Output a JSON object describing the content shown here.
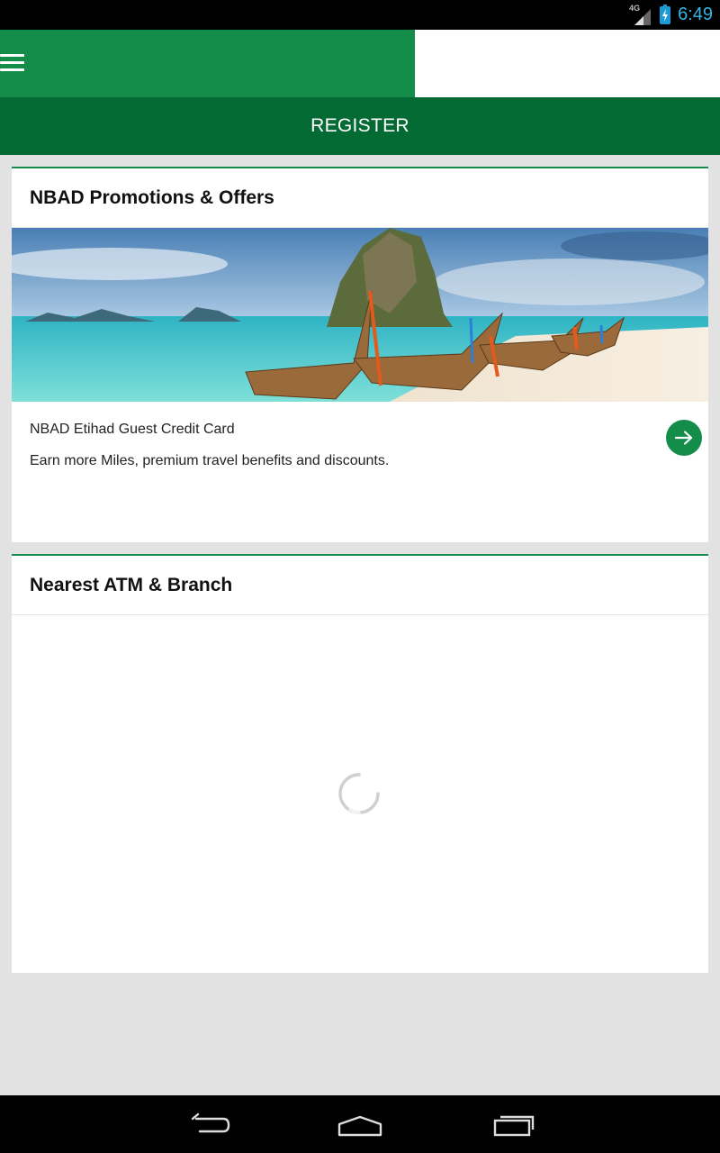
{
  "status_bar": {
    "network": "4G",
    "time": "6:49"
  },
  "header": {
    "menu_icon": "hamburger-menu-icon"
  },
  "register": {
    "label": "REGISTER"
  },
  "promotions": {
    "title": "NBAD Promotions & Offers",
    "offer": {
      "name": "NBAD Etihad Guest Credit Card",
      "description": "Earn more Miles, premium travel benefits and discounts.",
      "action_icon": "arrow-right-icon"
    }
  },
  "atm": {
    "title": "Nearest ATM & Branch",
    "loading_icon": "loading-spinner-icon"
  },
  "nav": {
    "back_icon": "back-icon",
    "home_icon": "home-icon",
    "recent_icon": "recent-apps-icon"
  },
  "colors": {
    "brand_green": "#148c4a",
    "dark_green": "#046a33",
    "status_blue": "#33b5e5"
  }
}
